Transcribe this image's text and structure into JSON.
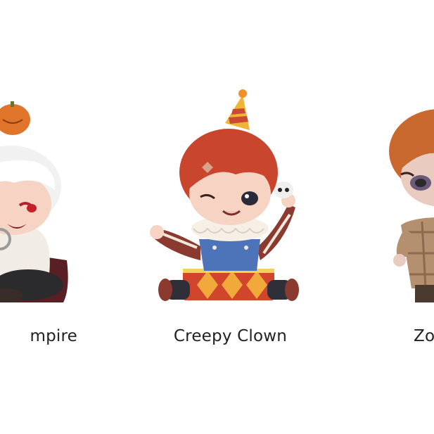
{
  "items": [
    {
      "label": "mpire",
      "figure": "vampire-figure"
    },
    {
      "label": "Creepy Clown",
      "figure": "creepy-clown-figure"
    },
    {
      "label": "Zo",
      "figure": "zombie-figure"
    }
  ],
  "colors": {
    "background": "#ffffff",
    "caption_text": "#222222",
    "clown_hair": "#c9452e",
    "clown_overalls": "#4d73b8",
    "clown_stripes": "#8a3a2e",
    "pumpkin": "#e0742a",
    "zombie_hair": "#c9692f"
  }
}
